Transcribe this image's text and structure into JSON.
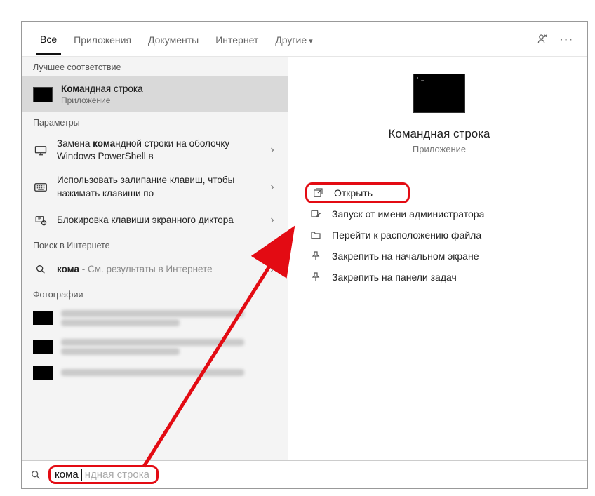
{
  "tabs": {
    "all": "Все",
    "apps": "Приложения",
    "docs": "Документы",
    "web": "Интернет",
    "more": "Другие"
  },
  "left": {
    "best_match_header": "Лучшее соответствие",
    "best_match": {
      "title_prefix_bold": "Кома",
      "title_rest": "ндная строка",
      "subtitle": "Приложение"
    },
    "settings_header": "Параметры",
    "settings": [
      {
        "pre": "Замена ",
        "bold": "кома",
        "post": "ндной строки на оболочку Windows PowerShell в"
      },
      {
        "pre": "Использовать залипание клавиш, чтобы нажимать клавиши по",
        "bold": "",
        "post": ""
      },
      {
        "pre": "Блокировка клавиши экранного диктора",
        "bold": "",
        "post": ""
      }
    ],
    "web_header": "Поиск в Интернете",
    "web_item": {
      "bold": "кома",
      "muted": " - См. результаты в Интернете"
    },
    "photos_header": "Фотографии"
  },
  "right": {
    "title": "Командная строка",
    "subtitle": "Приложение",
    "actions": {
      "open": "Открыть",
      "admin": "Запуск от имени администратора",
      "location": "Перейти к расположению файла",
      "pin_start": "Закрепить на начальном экране",
      "pin_taskbar": "Закрепить на панели задач"
    }
  },
  "search": {
    "typed": "кома",
    "completion": "ндная строка"
  }
}
